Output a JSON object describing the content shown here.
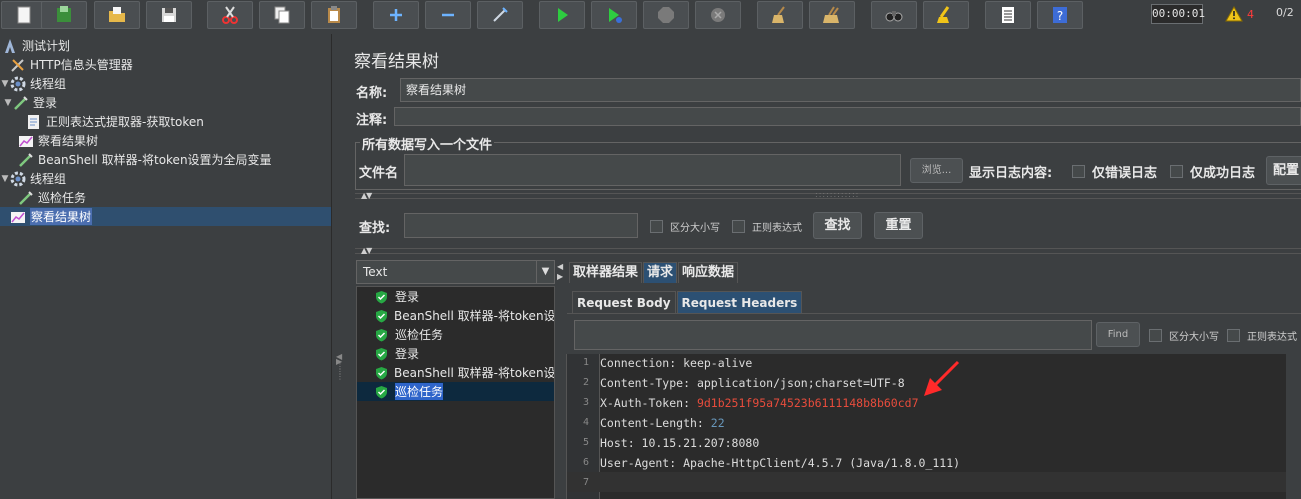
{
  "toolbar": {
    "buttons": [
      {
        "name": "new-button",
        "icon": "new-file-icon"
      },
      {
        "name": "templates-button",
        "icon": "templates-icon"
      },
      {
        "name": "open-button",
        "icon": "folder-open-icon"
      },
      {
        "name": "save-button",
        "icon": "save-icon"
      },
      {
        "name": "cut-button",
        "icon": "scissors-icon"
      },
      {
        "name": "copy-button",
        "icon": "copy-icon"
      },
      {
        "name": "paste-button",
        "icon": "paste-icon"
      },
      {
        "name": "expand-button",
        "icon": "plus-icon"
      },
      {
        "name": "collapse-button",
        "icon": "minus-icon"
      },
      {
        "name": "toggle-button",
        "icon": "wand-icon"
      },
      {
        "name": "start-button",
        "icon": "play-icon"
      },
      {
        "name": "start-no-pause-button",
        "icon": "play-no-pause-icon"
      },
      {
        "name": "stop-button",
        "icon": "stop-icon"
      },
      {
        "name": "shutdown-button",
        "icon": "shutdown-icon"
      },
      {
        "name": "clear-button",
        "icon": "broom-icon"
      },
      {
        "name": "clear-all-button",
        "icon": "broom-all-icon"
      },
      {
        "name": "search-button",
        "icon": "binoculars-icon"
      },
      {
        "name": "reset-search-button",
        "icon": "eraser-icon"
      },
      {
        "name": "function-helper-button",
        "icon": "list-icon"
      },
      {
        "name": "help-button",
        "icon": "help-icon"
      }
    ],
    "timer": "00:00:01",
    "warning_count": "4",
    "threads": "0/2"
  },
  "tree": {
    "items": [
      {
        "label": "测试计划",
        "icon": "test-plan-icon",
        "level": 0
      },
      {
        "label": "HTTP信息头管理器",
        "icon": "header-manager-icon",
        "level": 1
      },
      {
        "label": "线程组",
        "icon": "gear-icon",
        "level": 0
      },
      {
        "label": "登录",
        "icon": "sampler-icon",
        "level": 1
      },
      {
        "label": "正则表达式提取器-获取token",
        "icon": "extractor-icon",
        "level": 2
      },
      {
        "label": "察看结果树",
        "icon": "listener-icon",
        "level": 1
      },
      {
        "label": "BeanShell 取样器-将token设置为全局变量",
        "icon": "sampler-icon",
        "level": 1
      },
      {
        "label": "线程组",
        "icon": "gear-icon",
        "level": 0
      },
      {
        "label": "巡检任务",
        "icon": "sampler-icon",
        "level": 1
      },
      {
        "label": "察看结果树",
        "icon": "listener-icon",
        "level": 1
      }
    ]
  },
  "panel": {
    "title": "察看结果树",
    "name_label": "名称:",
    "name_value": "察看结果树",
    "comment_label": "注释:",
    "comment_value": "",
    "group_title": "所有数据写入一个文件",
    "filename_label": "文件名",
    "filename_value": "",
    "browse_label": "浏览...",
    "log_label": "显示日志内容:",
    "errors_only_label": "仅错误日志",
    "success_only_label": "仅成功日志",
    "configure_label": "配置",
    "search_label": "查找:",
    "search_value": "",
    "case_label": "区分大小写",
    "regex_label": "正则表达式",
    "search_button": "查找",
    "reset_button": "重置"
  },
  "results": {
    "renderer": "Text",
    "items": [
      "登录",
      "BeanShell 取样器-将token设置为全局变量",
      "巡检任务",
      "登录",
      "BeanShell 取样器-将token设置为全局变量",
      "巡检任务"
    ],
    "selected_index": 5
  },
  "tabs": {
    "main": [
      "取样器结果",
      "请求",
      "响应数据"
    ],
    "main_active": 1,
    "sub": [
      "Request Body",
      "Request Headers"
    ],
    "sub_active": 1
  },
  "find_bar": {
    "value": "",
    "find_label": "Find",
    "case_label": "区分大小写",
    "regex_label": "正则表达式"
  },
  "code": {
    "lines": [
      {
        "n": "1",
        "key": "Connection: ",
        "val": "keep-alive"
      },
      {
        "n": "2",
        "key": "Content-Type: ",
        "val": "application/json;charset=UTF-8"
      },
      {
        "n": "3",
        "key": "X-Auth-Token: ",
        "val": "9d1b251f95a74523b6111148b8b60cd7"
      },
      {
        "n": "4",
        "key": "Content-Length: ",
        "val": "22"
      },
      {
        "n": "5",
        "key": "Host: ",
        "val": "10.15.21.207:8080"
      },
      {
        "n": "6",
        "key": "User-Agent: ",
        "val": "Apache-HttpClient/4.5.7 (Java/1.8.0_111)"
      },
      {
        "n": "7",
        "key": "",
        "val": ""
      }
    ]
  },
  "colors": {
    "background": "#3c3f41",
    "editor": "#2b2b2b",
    "selection": "#2f65ca",
    "token": "#e74c3c",
    "annotation_arrow": "#ff2a2a"
  }
}
